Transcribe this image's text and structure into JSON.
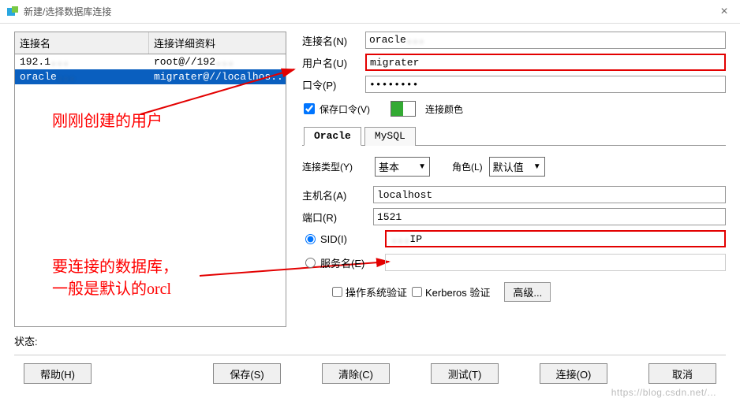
{
  "window": {
    "title": "新建/选择数据库连接"
  },
  "connTable": {
    "header": {
      "name": "连接名",
      "detail": "连接详细资料"
    },
    "rows": [
      {
        "name": "192.1",
        "name_blur": "...",
        "detail": "root@//192",
        "detail_blur": "..."
      },
      {
        "name": "oracle",
        "name_blur": "...",
        "detail": "migrater@//localhos..."
      }
    ]
  },
  "form": {
    "connName": {
      "label": "连接名(N)",
      "value": "oracle",
      "value_blur": "..."
    },
    "username": {
      "label": "用户名(U)",
      "value": "migrater"
    },
    "password": {
      "label": "口令(P)",
      "value": "••••••••"
    },
    "savePwd": "保存口令(V)",
    "connColor": "连接颜色"
  },
  "tabs": {
    "oracle": "Oracle",
    "mysql": "MySQL"
  },
  "oracleTab": {
    "connType": {
      "label": "连接类型(Y)",
      "value": "基本"
    },
    "role": {
      "label": "角色(L)",
      "value": "默认值"
    },
    "host": {
      "label": "主机名(A)",
      "value": "localhost"
    },
    "port": {
      "label": "端口(R)",
      "value": "1521"
    },
    "sid": {
      "label": "SID(I)",
      "value": "IP",
      "value_blur": "..."
    },
    "service": {
      "label": "服务名(E)",
      "value": ""
    },
    "osAuth": "操作系统验证",
    "kerberos": "Kerberos 验证",
    "advanced": "高级..."
  },
  "status": {
    "label": "状态:"
  },
  "buttons": {
    "help": "帮助(H)",
    "save": "保存(S)",
    "clear": "清除(C)",
    "test": "测试(T)",
    "connect": "连接(O)",
    "cancel": "取消"
  },
  "annotations": {
    "userNote": "刚刚创建的用户",
    "dbNote1": "要连接的数据库，",
    "dbNote2": "一般是默认的orcl"
  },
  "watermark": "https://blog.csdn.net/..."
}
